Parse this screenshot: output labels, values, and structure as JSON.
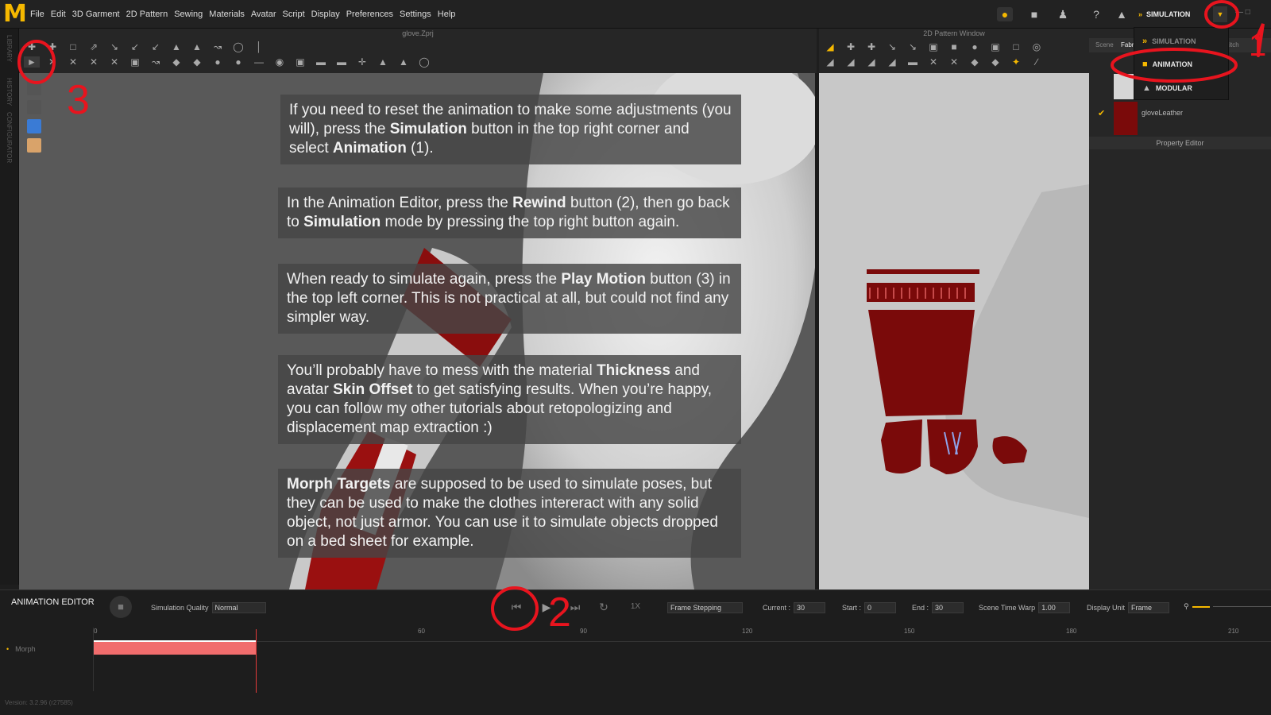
{
  "menubar": {
    "logo": "M",
    "items": [
      "File",
      "Edit",
      "3D Garment",
      "2D Pattern",
      "Sewing",
      "Materials",
      "Avatar",
      "Script",
      "Display",
      "Preferences",
      "Settings",
      "Help"
    ],
    "mode_button": "SIMULATION"
  },
  "side_tabs": [
    "LIBRARY",
    "HISTORY",
    "CONFIGURATOR"
  ],
  "windows": {
    "3d_title": "glove.Zprj",
    "2d_title": "2D Pattern Window"
  },
  "mode_menu": {
    "items": [
      {
        "label": "SIMULATION",
        "icon": "simulation-icon"
      },
      {
        "label": "ANIMATION",
        "icon": "camera-icon"
      },
      {
        "label": "MODULAR",
        "icon": "shirt-icon"
      }
    ]
  },
  "right_panel": {
    "tabs": [
      "Scene",
      "Fabr",
      "stitch"
    ],
    "fabric_name": "gloveLeather",
    "property_editor": "Property Editor"
  },
  "notes": [
    {
      "parts": [
        {
          "t": "If you need to reset the animation to make some adjustments (you will), press the ",
          "b": false
        },
        {
          "t": "Simulation",
          "b": true
        },
        {
          "t": " button in the top right corner and select ",
          "b": false
        },
        {
          "t": "Animation",
          "b": true
        },
        {
          "t": " (1).",
          "b": false
        }
      ]
    },
    {
      "parts": [
        {
          "t": "In the Animation Editor, press the ",
          "b": false
        },
        {
          "t": "Rewind",
          "b": true
        },
        {
          "t": " button (2), then go back to ",
          "b": false
        },
        {
          "t": "Simulation",
          "b": true
        },
        {
          "t": " mode by pressing the top right button again.",
          "b": false
        }
      ]
    },
    {
      "parts": [
        {
          "t": "When ready to simulate again, press the ",
          "b": false
        },
        {
          "t": "Play Motion",
          "b": true
        },
        {
          "t": " button (3) in the top left corner. This is not practical at all, but could not find any simpler way.",
          "b": false
        }
      ]
    },
    {
      "parts": [
        {
          "t": "You’ll probably have to mess with the material ",
          "b": false
        },
        {
          "t": "Thickness",
          "b": true
        },
        {
          "t": " and avatar ",
          "b": false
        },
        {
          "t": "Skin Offset",
          "b": true
        },
        {
          "t": " to get satisfying results. When you’re happy, you can follow my other tutorials about retopologizing and displacement map extraction :)",
          "b": false
        }
      ]
    },
    {
      "parts": [
        {
          "t": "Morph Targets",
          "b": true
        },
        {
          "t": " are supposed to be used to simulate poses, but they can be used to make the clothes intereract with any solid object, not just armor. You can use it to simulate objects dropped on a bed sheet for example.",
          "b": false
        }
      ]
    }
  ],
  "annotations": {
    "one": "1",
    "two": "2",
    "three": "3"
  },
  "animation_editor": {
    "title": "ANIMATION EDITOR",
    "sim_quality_label": "Simulation Quality",
    "sim_quality_value": "Normal",
    "speed": "1X",
    "frame_mode": "Frame Stepping",
    "current_label": "Current :",
    "current_value": "30",
    "start_label": "Start :",
    "start_value": "0",
    "end_label": "End :",
    "end_value": "30",
    "warp_label": "Scene Time Warp",
    "warp_value": "1.00",
    "unit_label": "Display Unit",
    "unit_value": "Frame",
    "ruler_ticks": [
      "0",
      "60",
      "90",
      "120",
      "150",
      "180",
      "210"
    ],
    "track_name": "Morph",
    "version": "Version: 3.2.96    (r27585)"
  },
  "colors": {
    "accent": "#f5b800",
    "annotation": "#e8141e",
    "fabric": "#7a0a0a",
    "track": "#f16d6d"
  }
}
